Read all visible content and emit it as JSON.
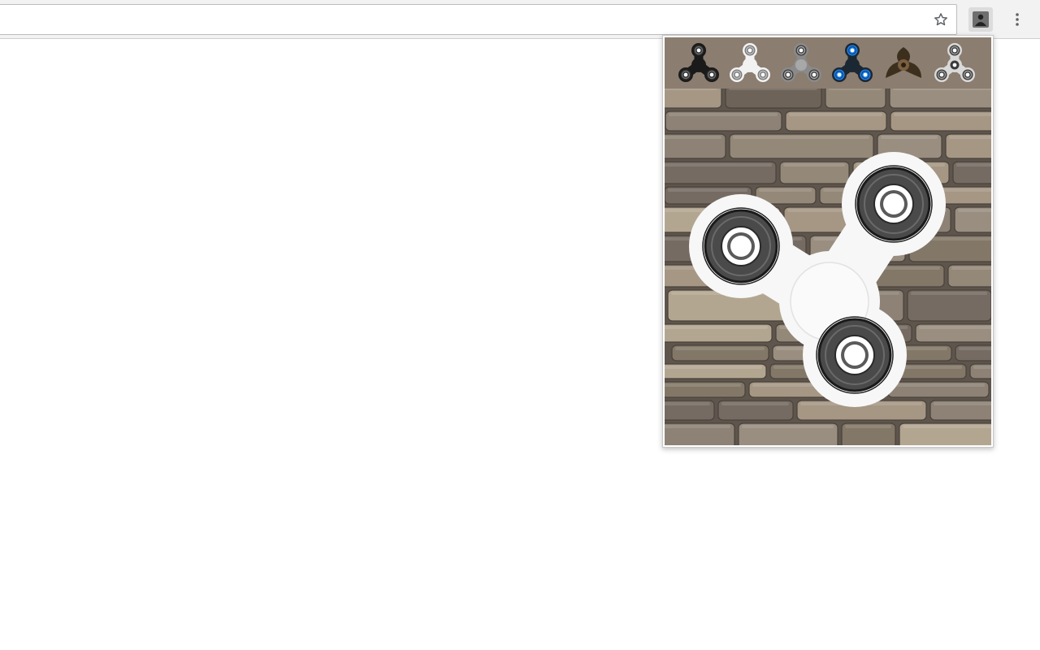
{
  "browser": {
    "address_bar": {
      "value": "",
      "placeholder": ""
    },
    "toolbar_icons": [
      "star-icon",
      "extension-icon",
      "more-vert-icon"
    ]
  },
  "popup": {
    "picker": {
      "background": "#8b7d6f",
      "options": [
        {
          "icon": "spinner-black-icon",
          "arm": "#1a1a1a",
          "bearing": "#2a2a2a",
          "ring": "#6b6b6b"
        },
        {
          "icon": "spinner-white-icon",
          "arm": "#f2f2f2",
          "bearing": "#7a7a7a",
          "ring": "#bdbdbd"
        },
        {
          "icon": "spinner-gray-icon",
          "arm": "#8a8a8a",
          "bearing": "#3a3a3a",
          "ring": "#a8a8a8"
        },
        {
          "icon": "spinner-blue-icon",
          "arm": "#1b2733",
          "bearing": "#1e88e5",
          "ring": "#0d47a1"
        },
        {
          "icon": "spinner-bronze-icon",
          "arm": "#3d2f1e",
          "bearing": "#5a4630",
          "ring": "#7a6040"
        },
        {
          "icon": "spinner-silver-icon",
          "arm": "#d9d9d9",
          "bearing": "#3a3a3a",
          "ring": "#9a9a9a"
        }
      ]
    },
    "stage": {
      "background": "stone-wall",
      "selected_spinner": "spinner-white-icon",
      "spinner_colors": {
        "arm": "#f7f7f7",
        "bearing": "#4a4a4a",
        "race": "#ffffff"
      }
    }
  }
}
